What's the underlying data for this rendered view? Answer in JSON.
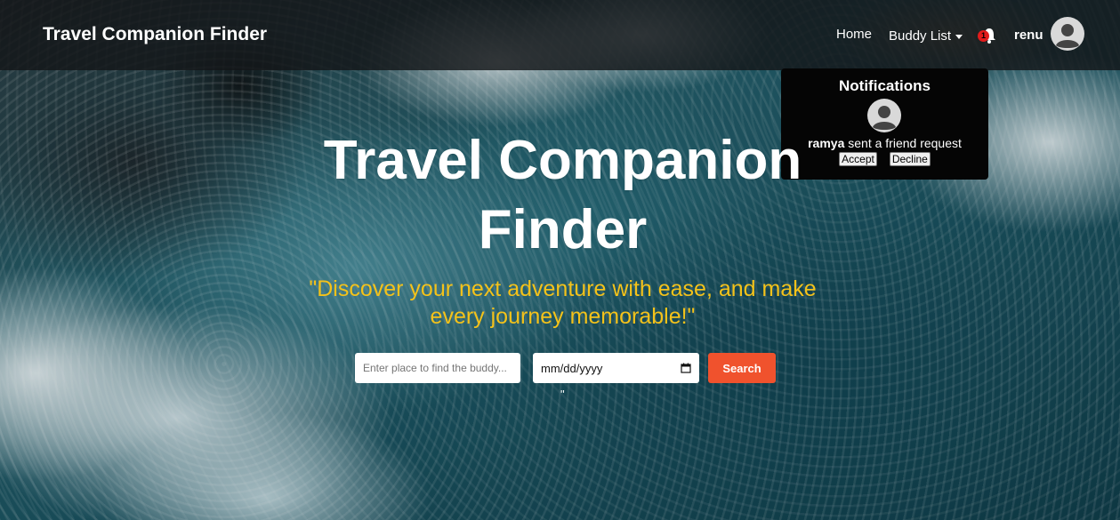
{
  "navbar": {
    "brand": "Travel Companion Finder",
    "home": "Home",
    "buddy_list": "Buddy List",
    "notification_count": "1",
    "username": "renu"
  },
  "notifications": {
    "title": "Notifications",
    "items": [
      {
        "sender": "ramya",
        "message": "sent a friend request",
        "accept_label": "Accept",
        "decline_label": "Decline"
      }
    ]
  },
  "hero": {
    "title": "Travel Companion Finder",
    "tagline": "\"Discover your next adventure with ease, and make every journey memorable!\"",
    "search": {
      "place_placeholder": "Enter place to find the buddy...",
      "date_value": "mm/dd/yyyy",
      "button_label": "Search"
    },
    "stray_text": "\""
  },
  "colors": {
    "tagline": "#f4c21a",
    "search_button": "#f0522d",
    "badge": "#e21b1b",
    "navbar_bg": "rgba(20,22,24,0.82)"
  },
  "icons": [
    "bell-icon",
    "avatar-icon",
    "calendar-icon",
    "caret-down-icon"
  ]
}
